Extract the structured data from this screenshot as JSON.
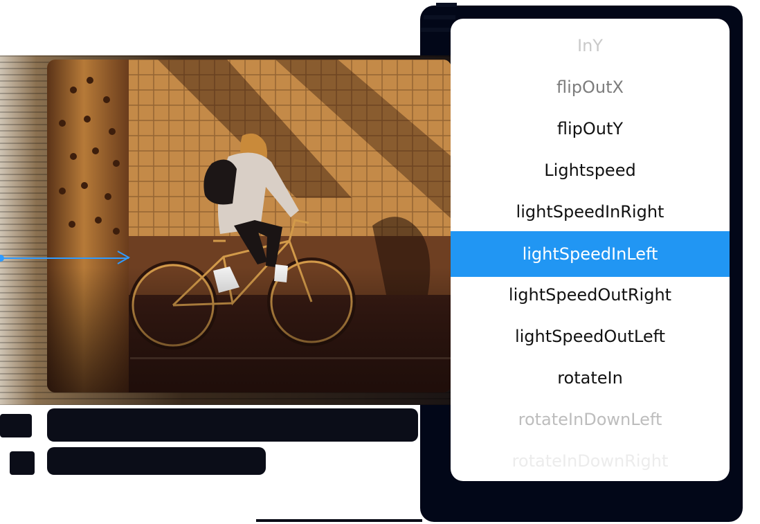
{
  "animation_list": {
    "items": [
      {
        "label": "InY",
        "state": "faded"
      },
      {
        "label": "flipOutX",
        "state": "faded"
      },
      {
        "label": "flipOutY",
        "state": "normal"
      },
      {
        "label": "Lightspeed",
        "state": "normal"
      },
      {
        "label": "lightSpeedInRight",
        "state": "normal"
      },
      {
        "label": "lightSpeedInLeft",
        "state": "selected"
      },
      {
        "label": "lightSpeedOutRight",
        "state": "normal"
      },
      {
        "label": "lightSpeedOutLeft",
        "state": "normal"
      },
      {
        "label": "rotateIn",
        "state": "normal"
      },
      {
        "label": "rotateInDownLeft",
        "state": "faded"
      },
      {
        "label": "rotateInDownRight",
        "state": "faded"
      }
    ],
    "selected_color": "#2196f3"
  },
  "theme": {
    "accent": "#2f9bff",
    "backdrop": "#020718"
  }
}
